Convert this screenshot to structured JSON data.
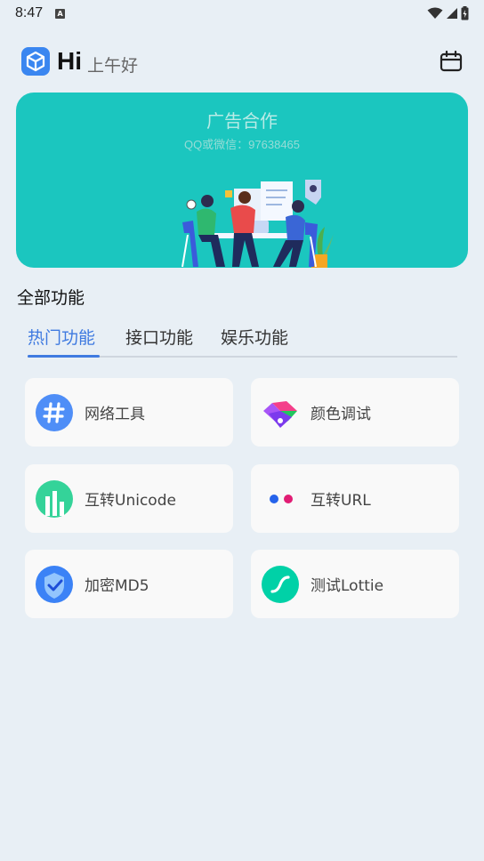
{
  "status": {
    "time": "8:47"
  },
  "header": {
    "hi": "Hi",
    "greeting": "上午好"
  },
  "banner": {
    "title": "广告合作",
    "subtitle": "QQ或微信：97638465"
  },
  "section": {
    "title": "全部功能"
  },
  "tabs": [
    {
      "label": "热门功能"
    },
    {
      "label": "接口功能"
    },
    {
      "label": "娱乐功能"
    }
  ],
  "features": [
    {
      "label": "网络工具",
      "icon": "hash-icon"
    },
    {
      "label": "颜色调试",
      "icon": "palette-icon"
    },
    {
      "label": "互转Unicode",
      "icon": "bar-chart-icon"
    },
    {
      "label": "互转URL",
      "icon": "dots-icon"
    },
    {
      "label": "加密MD5",
      "icon": "shield-check-icon"
    },
    {
      "label": "测试Lottie",
      "icon": "lottie-icon"
    }
  ],
  "colors": {
    "accent": "#3f7ae0",
    "banner": "#1bc6bf",
    "background": "#e8eff5"
  }
}
